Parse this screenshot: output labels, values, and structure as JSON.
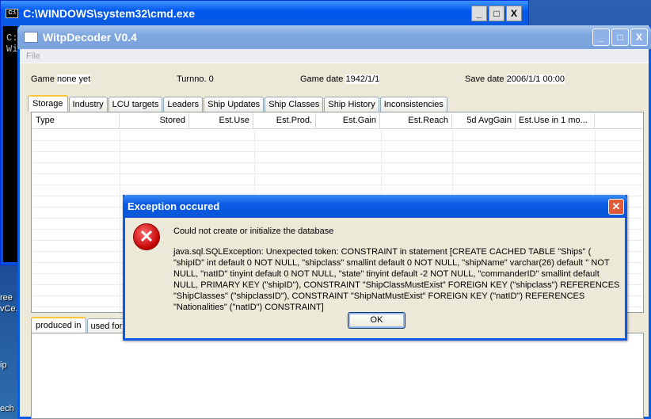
{
  "desktop": {
    "icon_labels": [
      "ree",
      "vCe..",
      "ip",
      "ech"
    ]
  },
  "cmd": {
    "title": "C:\\WINDOWS\\system32\\cmd.exe",
    "lines": [
      "C:",
      "Wi"
    ]
  },
  "app": {
    "title": "WitpDecoder V0.4",
    "menu": [
      "File"
    ],
    "info": {
      "game_label": "Game",
      "game_value": "none yet",
      "turn_label": "Turnno.",
      "turn_value": "0",
      "game_date_label": "Game date",
      "game_date_value": "1942/1/1",
      "save_date_label": "Save date",
      "save_date_value": "2006/1/1 00:00"
    },
    "tabs": [
      "Storage",
      "Industry",
      "LCU targets",
      "Leaders",
      "Ship Updates",
      "Ship Classes",
      "Ship History",
      "Inconsistencies"
    ],
    "columns": [
      "Type",
      "Stored",
      "Est.Use",
      "Est.Prod.",
      "Est.Gain",
      "Est.Reach",
      "5d AvgGain",
      "Est.Use in 1 mo..."
    ],
    "bottom_tabs": [
      "produced in",
      "used for"
    ]
  },
  "dialog": {
    "title": "Exception occured",
    "message": "Could not create or initialize the database",
    "detail": "java.sql.SQLException: Unexpected token: CONSTRAINT in statement [CREATE CACHED TABLE \"Ships\" ( \"shipID\" int default 0 NOT NULL, \"shipclass\" smallint default 0 NOT NULL, \"shipName\" varchar(26) default '' NOT NULL, \"natID\" tinyint default 0 NOT NULL, \"state\" tinyint default -2 NOT NULL, \"commanderID\" smallint default NULL, PRIMARY KEY (\"shipID\"), CONSTRAINT \"ShipClassMustExist\" FOREIGN KEY (\"shipclass\") REFERENCES \"ShipClasses\" (\"shipclassID\"), CONSTRAINT \"ShipNatMustExist\" FOREIGN KEY (\"natID\") REFERENCES \"Nationalities\" (\"natID\") CONSTRAINT]",
    "ok": "OK"
  }
}
